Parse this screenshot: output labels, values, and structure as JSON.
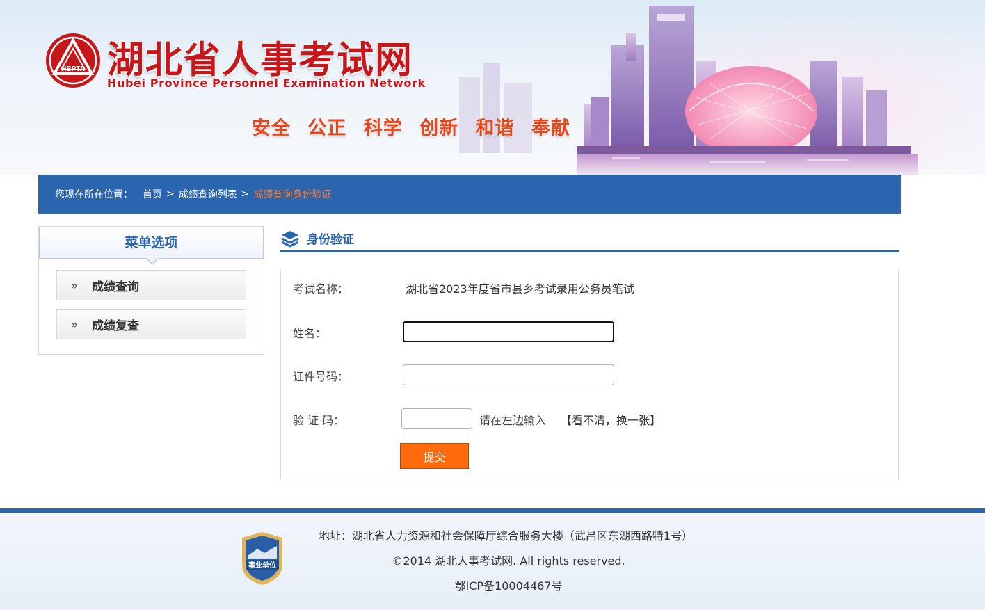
{
  "header": {
    "site_title": "湖北省人事考试网",
    "site_subtitle": "Hubei Province Personnel Examination Network",
    "logo_text": "HBPTA",
    "slogan": "安全 公正 科学 创新 和谐 奉献"
  },
  "breadcrumb": {
    "prefix": "您现在所在位置：",
    "items": [
      "首页",
      "成绩查询列表",
      "成绩查询身份验证"
    ],
    "separator": ">"
  },
  "sidebar": {
    "title": "菜单选项",
    "items": [
      {
        "label": "成绩查询",
        "arrow": "»"
      },
      {
        "label": "成绩复查",
        "arrow": "»"
      }
    ]
  },
  "panel": {
    "title": "身份验证"
  },
  "form": {
    "exam_label": "考试名称：",
    "exam_name": "湖北省2023年度省市县乡考试录用公务员笔试",
    "name_label": "姓名：",
    "name_value": "",
    "id_label": "证件号码：",
    "id_value": "",
    "captcha_label": "验 证 码：",
    "captcha_value": "",
    "captcha_tip": "请在左边输入",
    "refresh_label": "【看不清，换一张】",
    "submit_label": "提交"
  },
  "footer": {
    "badge_text": "事业单位",
    "address": "地址：湖北省人力资源和社会保障厅综合服务大楼（武昌区东湖西路特1号）",
    "copyright": "©2014 湖北人事考试网. All rights reserved.",
    "icp": "鄂ICP备10004467号"
  },
  "colors": {
    "brand_blue": "#2b65b0",
    "brand_red": "#c8171b",
    "accent_orange": "#ff6a0c",
    "current_crumb": "#ff7a2a"
  }
}
